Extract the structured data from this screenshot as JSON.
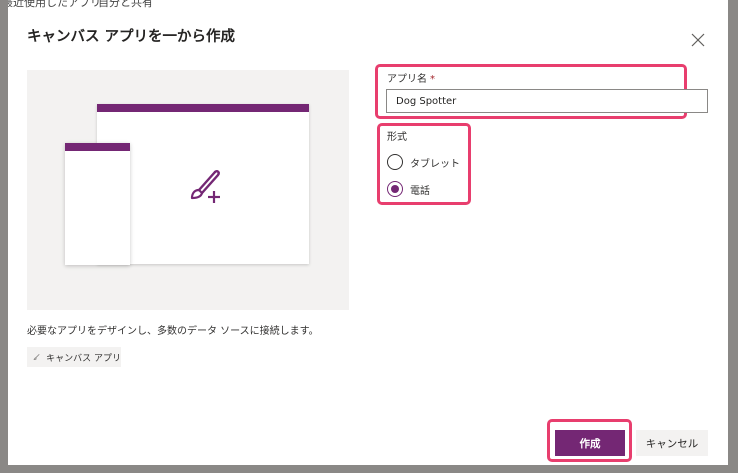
{
  "background": {
    "text_left": "最近使用したアプリ",
    "text_right": "自分と共有"
  },
  "dialog": {
    "title": "キャンバス アプリを一から作成",
    "close_icon": "close-icon",
    "description": "必要なアプリをデザインし、多数のデータ ソースに接続します。",
    "tag_label": "キャンバス アプリ"
  },
  "form": {
    "app_name_label": "アプリ名",
    "required_mark": "*",
    "app_name_value": "Dog Spotter",
    "format_label": "形式",
    "options": [
      {
        "label": "タブレット",
        "selected": false
      },
      {
        "label": "電話",
        "selected": true
      }
    ]
  },
  "buttons": {
    "create": "作成",
    "cancel": "キャンセル"
  },
  "colors": {
    "accent": "#742774",
    "highlight": "#e83e6e"
  }
}
